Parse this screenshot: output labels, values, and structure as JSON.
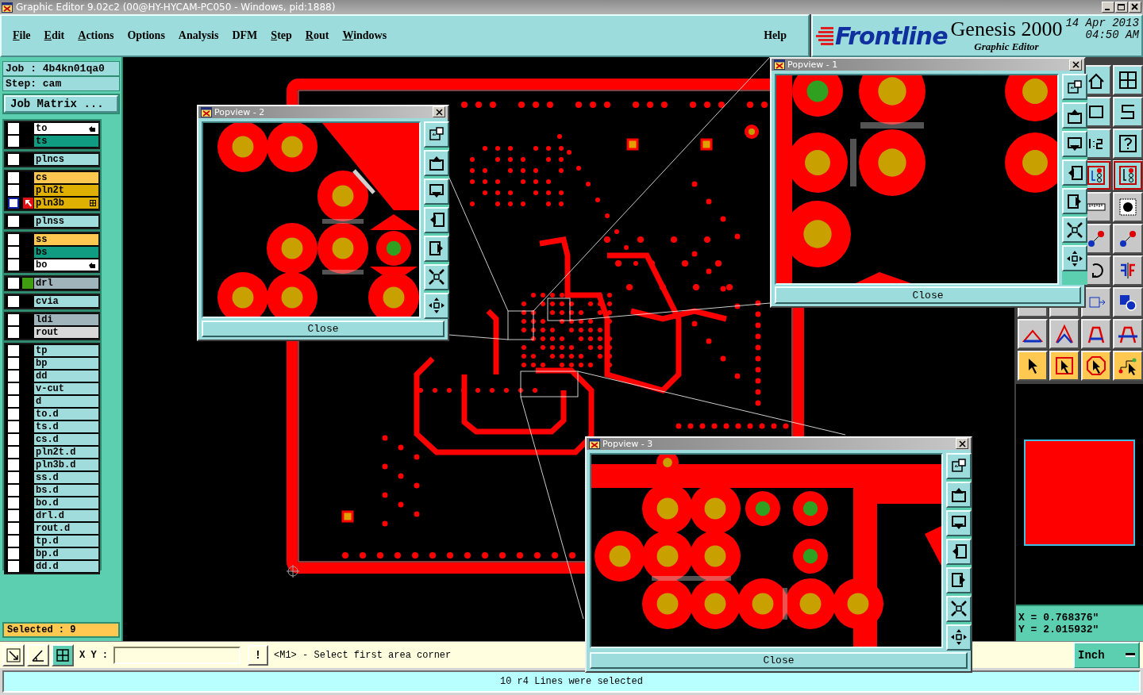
{
  "window": {
    "title": "Graphic Editor 9.02c2 (00@HY-HYCAM-PC050 - Windows, pid:1888)"
  },
  "menu": [
    {
      "label": "File",
      "mnemonic": true
    },
    {
      "label": "Edit",
      "mnemonic": true
    },
    {
      "label": "Actions",
      "mnemonic": true
    },
    {
      "label": "Options",
      "mnemonic": false
    },
    {
      "label": "Analysis",
      "mnemonic": false
    },
    {
      "label": "DFM",
      "mnemonic": false
    },
    {
      "label": "Step",
      "mnemonic": true
    },
    {
      "label": "Rout",
      "mnemonic": true
    },
    {
      "label": "Windows",
      "mnemonic": true
    }
  ],
  "help_menu": {
    "label": "Help",
    "mnemonic": false
  },
  "branding": {
    "logo": "Frontline",
    "product": "Genesis 2000",
    "subtitle": "Graphic Editor",
    "date": "14 Apr 2013",
    "time": "04:50 AM"
  },
  "job": {
    "job_line": "Job : 4b4kn01qa0",
    "step_line": "Step: cam",
    "matrix_button": "Job Matrix ..."
  },
  "layer_groups": [
    [
      {
        "name": "to",
        "color": "#ffffff",
        "checked": false,
        "work_layer": false,
        "hand_flag": true,
        "grid_flag": false,
        "affected": false
      },
      {
        "name": "ts",
        "color": "#109c80",
        "checked": false,
        "work_layer": false,
        "hand_flag": false,
        "grid_flag": false,
        "affected": false
      }
    ],
    [
      {
        "name": "plncs",
        "color": "#a0dcdc",
        "checked": false,
        "work_layer": false,
        "hand_flag": false,
        "grid_flag": false,
        "affected": false
      }
    ],
    [
      {
        "name": "cs",
        "color": "#ffc850",
        "checked": false,
        "work_layer": false,
        "hand_flag": false,
        "grid_flag": false,
        "affected": false
      },
      {
        "name": "pln2t",
        "color": "#e0b000",
        "checked": false,
        "work_layer": false,
        "hand_flag": false,
        "grid_flag": false,
        "affected": false
      },
      {
        "name": "pln3b",
        "color": "#e0b000",
        "checked": false,
        "work_layer": true,
        "hand_flag": false,
        "grid_flag": true,
        "affected": false
      }
    ],
    [
      {
        "name": "plnss",
        "color": "#a0dcdc",
        "checked": false,
        "work_layer": false,
        "hand_flag": false,
        "grid_flag": false,
        "affected": false
      }
    ],
    [
      {
        "name": "ss",
        "color": "#ffc850",
        "checked": false,
        "work_layer": false,
        "hand_flag": false,
        "grid_flag": false,
        "affected": false
      },
      {
        "name": "bs",
        "color": "#109c80",
        "checked": false,
        "work_layer": false,
        "hand_flag": false,
        "grid_flag": false,
        "affected": false
      },
      {
        "name": "bo",
        "color": "#ffffff",
        "checked": false,
        "work_layer": false,
        "hand_flag": true,
        "grid_flag": false,
        "affected": false
      }
    ],
    [
      {
        "name": "drl",
        "color": "#a0b4bc",
        "checked": false,
        "work_layer": false,
        "hand_flag": false,
        "grid_flag": false,
        "affected": true
      }
    ],
    [
      {
        "name": "cvia",
        "color": "#a0dcdc",
        "checked": false,
        "work_layer": false,
        "hand_flag": false,
        "grid_flag": false,
        "affected": false
      }
    ],
    [
      {
        "name": "ldi",
        "color": "#a0b4bc",
        "checked": false,
        "work_layer": false,
        "hand_flag": false,
        "grid_flag": false,
        "affected": false
      },
      {
        "name": "rout",
        "color": "#d8d8d8",
        "checked": false,
        "work_layer": false,
        "hand_flag": false,
        "grid_flag": false,
        "affected": false
      }
    ],
    [
      {
        "name": "tp",
        "color": "#a0dcdc",
        "checked": false,
        "work_layer": false,
        "hand_flag": false,
        "grid_flag": false,
        "affected": false
      },
      {
        "name": "bp",
        "color": "#a0dcdc",
        "checked": false,
        "work_layer": false,
        "hand_flag": false,
        "grid_flag": false,
        "affected": false
      },
      {
        "name": "dd",
        "color": "#a0dcdc",
        "checked": false,
        "work_layer": false,
        "hand_flag": false,
        "grid_flag": false,
        "affected": false
      },
      {
        "name": "v-cut",
        "color": "#a0dcdc",
        "checked": false,
        "work_layer": false,
        "hand_flag": false,
        "grid_flag": false,
        "affected": false
      },
      {
        "name": "d",
        "color": "#a0dcdc",
        "checked": false,
        "work_layer": false,
        "hand_flag": false,
        "grid_flag": false,
        "affected": false
      },
      {
        "name": "to.d",
        "color": "#a0dcdc",
        "checked": false,
        "work_layer": false,
        "hand_flag": false,
        "grid_flag": false,
        "affected": false
      },
      {
        "name": "ts.d",
        "color": "#a0dcdc",
        "checked": false,
        "work_layer": false,
        "hand_flag": false,
        "grid_flag": false,
        "affected": false
      },
      {
        "name": "cs.d",
        "color": "#a0dcdc",
        "checked": false,
        "work_layer": false,
        "hand_flag": false,
        "grid_flag": false,
        "affected": false
      },
      {
        "name": "pln2t.d",
        "color": "#a0dcdc",
        "checked": false,
        "work_layer": false,
        "hand_flag": false,
        "grid_flag": false,
        "affected": false
      },
      {
        "name": "pln3b.d",
        "color": "#a0dcdc",
        "checked": false,
        "work_layer": false,
        "hand_flag": false,
        "grid_flag": false,
        "affected": false
      },
      {
        "name": "ss.d",
        "color": "#a0dcdc",
        "checked": false,
        "work_layer": false,
        "hand_flag": false,
        "grid_flag": false,
        "affected": false
      },
      {
        "name": "bs.d",
        "color": "#a0dcdc",
        "checked": false,
        "work_layer": false,
        "hand_flag": false,
        "grid_flag": false,
        "affected": false
      },
      {
        "name": "bo.d",
        "color": "#a0dcdc",
        "checked": false,
        "work_layer": false,
        "hand_flag": false,
        "grid_flag": false,
        "affected": false
      },
      {
        "name": "drl.d",
        "color": "#a0dcdc",
        "checked": false,
        "work_layer": false,
        "hand_flag": false,
        "grid_flag": false,
        "affected": false
      },
      {
        "name": "rout.d",
        "color": "#a0dcdc",
        "checked": false,
        "work_layer": false,
        "hand_flag": false,
        "grid_flag": false,
        "affected": false
      },
      {
        "name": "tp.d",
        "color": "#a0dcdc",
        "checked": false,
        "work_layer": false,
        "hand_flag": false,
        "grid_flag": false,
        "affected": false
      },
      {
        "name": "bp.d",
        "color": "#a0dcdc",
        "checked": false,
        "work_layer": false,
        "hand_flag": false,
        "grid_flag": false,
        "affected": false
      },
      {
        "name": "dd.d",
        "color": "#a0dcdc",
        "checked": false,
        "work_layer": false,
        "hand_flag": false,
        "grid_flag": false,
        "affected": false
      }
    ]
  ],
  "selected_count": "Selected : 9",
  "popviews": [
    {
      "title": "Popview - 1",
      "close_button": "Close"
    },
    {
      "title": "Popview - 2",
      "close_button": "Close"
    },
    {
      "title": "Popview - 3",
      "close_button": "Close"
    }
  ],
  "coordinates": {
    "x": "X = 0.768376\"",
    "y": "Y = 2.015932\""
  },
  "bottom_bar": {
    "xy_label": "X Y :",
    "alert_button": "!",
    "prompt": "<M1> - Select first area corner",
    "units": "Inch"
  },
  "status": "10 r4 Lines were selected"
}
